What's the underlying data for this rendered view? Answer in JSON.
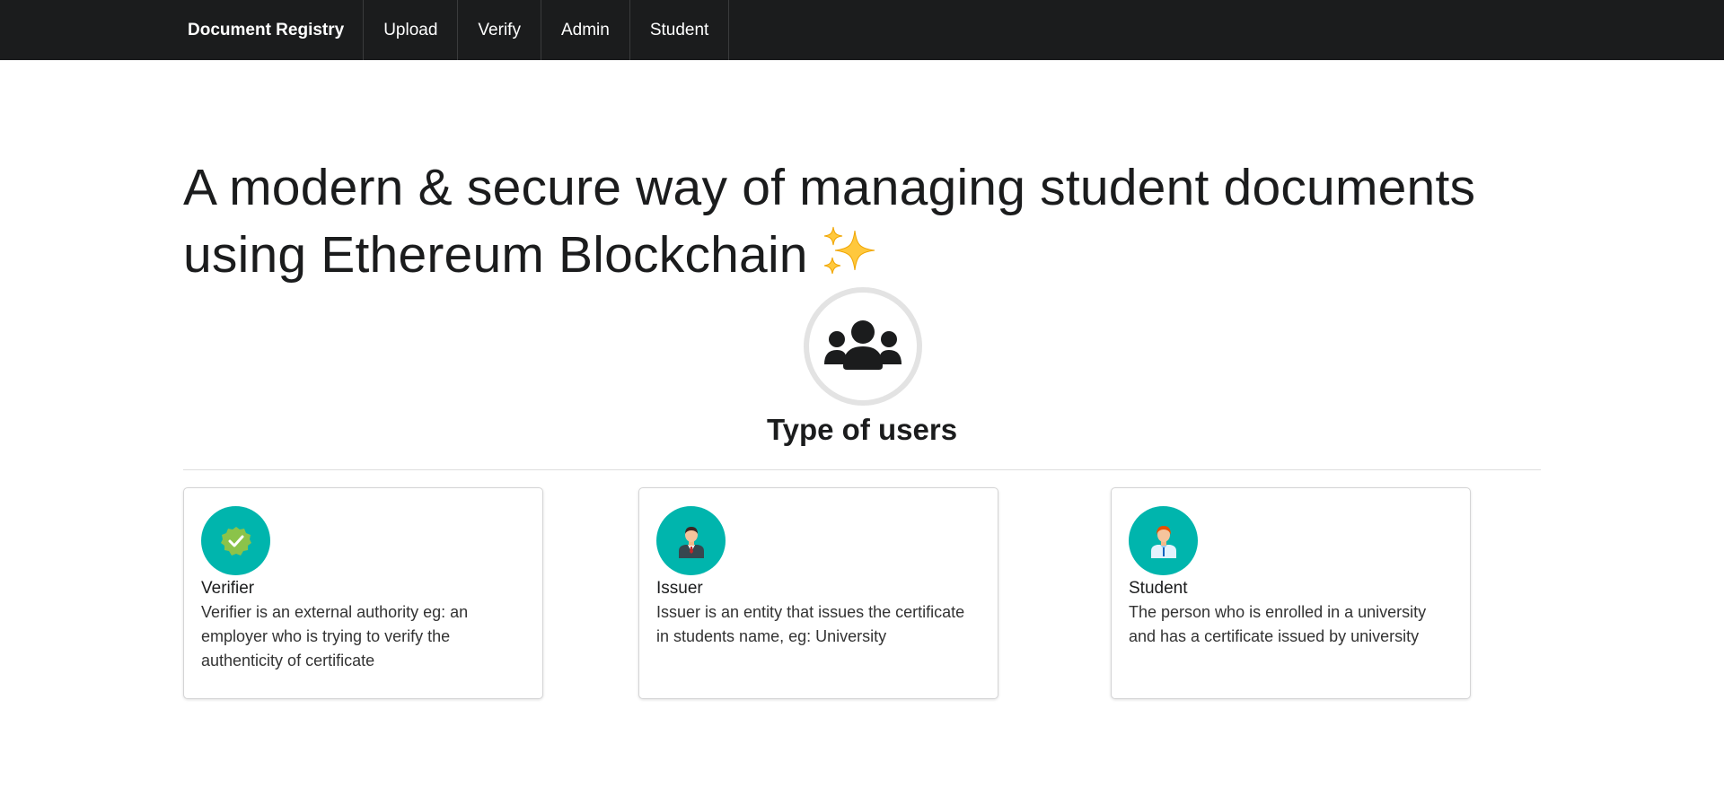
{
  "nav": {
    "brand": "Document Registry",
    "items": [
      "Upload",
      "Verify",
      "Admin",
      "Student"
    ]
  },
  "headline": {
    "text": "A modern & secure way of managing student documents using Ethereum Blockchain",
    "emoji_icon": "sparkles-icon"
  },
  "section": {
    "icon": "users-icon",
    "title": "Type of users"
  },
  "cards": [
    {
      "icon": "verified-badge-icon",
      "title": "Verifier",
      "description": "Verifier is an external authority eg: an employer who is trying to verify the authenticity of certificate"
    },
    {
      "icon": "businessman-icon",
      "title": "Issuer",
      "description": "Issuer is an entity that issues the certificate in students name, eg: University"
    },
    {
      "icon": "student-icon",
      "title": "Student",
      "description": "The person who is enrolled in a university and has a certificate issued by university"
    }
  ],
  "colors": {
    "navbar": "#1b1c1d",
    "accent_teal": "#00b5ad",
    "text": "#1b1c1d"
  }
}
